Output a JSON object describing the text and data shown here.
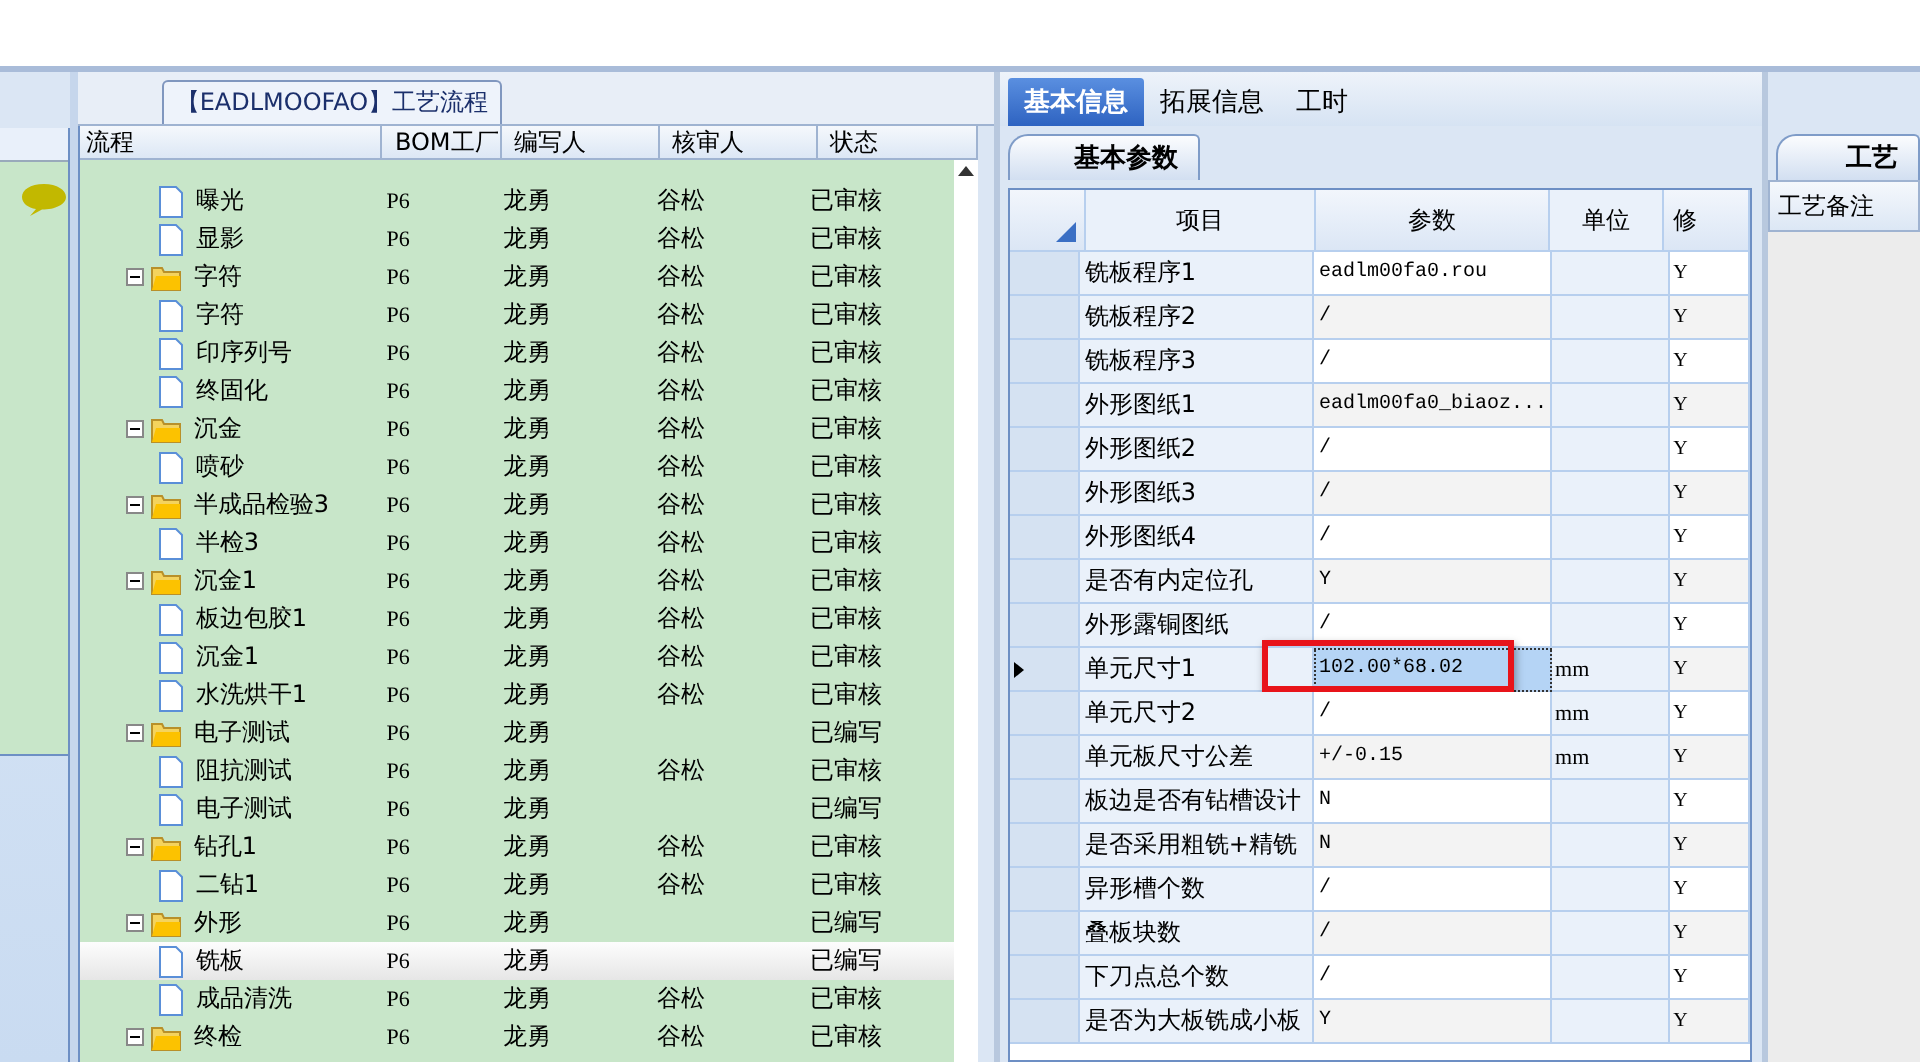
{
  "tree_panel": {
    "title": "【EADLMOOFAO】工艺流程",
    "columns": [
      "流程",
      "BOM工厂",
      "编写人",
      "核审人",
      "状态"
    ],
    "rows": [
      {
        "name": "曝光",
        "kind": "file",
        "bom": "P6",
        "writer": "龙勇",
        "reviewer": "谷松",
        "status": "已审核",
        "selected": false
      },
      {
        "name": "显影",
        "kind": "file",
        "bom": "P6",
        "writer": "龙勇",
        "reviewer": "谷松",
        "status": "已审核",
        "selected": false
      },
      {
        "name": "字符",
        "kind": "folder",
        "expanded": true,
        "bom": "P6",
        "writer": "龙勇",
        "reviewer": "谷松",
        "status": "已审核",
        "selected": false,
        "children": [
          {
            "name": "字符",
            "kind": "file",
            "bom": "P6",
            "writer": "龙勇",
            "reviewer": "谷松",
            "status": "已审核",
            "selected": false
          },
          {
            "name": "印序列号",
            "kind": "file",
            "bom": "P6",
            "writer": "龙勇",
            "reviewer": "谷松",
            "status": "已审核",
            "selected": false
          },
          {
            "name": "终固化",
            "kind": "file",
            "bom": "P6",
            "writer": "龙勇",
            "reviewer": "谷松",
            "status": "已审核",
            "selected": false
          }
        ]
      },
      {
        "name": "沉金",
        "kind": "folder",
        "expanded": true,
        "bom": "P6",
        "writer": "龙勇",
        "reviewer": "谷松",
        "status": "已审核",
        "selected": false,
        "children": [
          {
            "name": "喷砂",
            "kind": "file",
            "bom": "P6",
            "writer": "龙勇",
            "reviewer": "谷松",
            "status": "已审核",
            "selected": false
          }
        ]
      },
      {
        "name": "半成品检验3",
        "kind": "folder",
        "expanded": true,
        "bom": "P6",
        "writer": "龙勇",
        "reviewer": "谷松",
        "status": "已审核",
        "selected": false,
        "children": [
          {
            "name": "半检3",
            "kind": "file",
            "bom": "P6",
            "writer": "龙勇",
            "reviewer": "谷松",
            "status": "已审核",
            "selected": false
          }
        ]
      },
      {
        "name": "沉金1",
        "kind": "folder",
        "expanded": true,
        "bom": "P6",
        "writer": "龙勇",
        "reviewer": "谷松",
        "status": "已审核",
        "selected": false,
        "children": [
          {
            "name": "板边包胶1",
            "kind": "file",
            "bom": "P6",
            "writer": "龙勇",
            "reviewer": "谷松",
            "status": "已审核",
            "selected": false
          },
          {
            "name": "沉金1",
            "kind": "file",
            "bom": "P6",
            "writer": "龙勇",
            "reviewer": "谷松",
            "status": "已审核",
            "selected": false
          },
          {
            "name": "水洗烘干1",
            "kind": "file",
            "bom": "P6",
            "writer": "龙勇",
            "reviewer": "谷松",
            "status": "已审核",
            "selected": false
          }
        ]
      },
      {
        "name": "电子测试",
        "kind": "folder",
        "expanded": true,
        "bom": "P6",
        "writer": "龙勇",
        "status": "已编写",
        "selected": false,
        "children": [
          {
            "name": "阻抗测试",
            "kind": "file",
            "bom": "P6",
            "writer": "龙勇",
            "reviewer": "谷松",
            "status": "已审核",
            "selected": false
          },
          {
            "name": "电子测试",
            "kind": "file",
            "bom": "P6",
            "writer": "龙勇",
            "status": "已编写",
            "selected": false
          }
        ]
      },
      {
        "name": "钻孔1",
        "kind": "folder",
        "expanded": true,
        "bom": "P6",
        "writer": "龙勇",
        "reviewer": "谷松",
        "status": "已审核",
        "selected": false,
        "children": [
          {
            "name": "二钻1",
            "kind": "file",
            "bom": "P6",
            "writer": "龙勇",
            "reviewer": "谷松",
            "status": "已审核",
            "selected": false
          }
        ]
      },
      {
        "name": "外形",
        "kind": "folder",
        "expanded": true,
        "bom": "P6",
        "writer": "龙勇",
        "status": "已编写",
        "selected": false,
        "children": [
          {
            "name": "铣板",
            "kind": "file",
            "bom": "P6",
            "writer": "龙勇",
            "status": "已编写",
            "selected": true
          },
          {
            "name": "成品清洗",
            "kind": "file",
            "bom": "P6",
            "writer": "龙勇",
            "reviewer": "谷松",
            "status": "已审核",
            "selected": false
          }
        ]
      },
      {
        "name": "终检",
        "kind": "folder",
        "expanded": true,
        "bom": "P6",
        "writer": "龙勇",
        "reviewer": "谷松",
        "status": "已审核",
        "selected": false
      }
    ]
  },
  "info_panel": {
    "tabs": [
      {
        "label": "基本信息",
        "selected": true
      },
      {
        "label": "拓展信息",
        "selected": false
      },
      {
        "label": "工时",
        "selected": false
      }
    ],
    "subtab": "基本参数",
    "columns": [
      "项目",
      "参数",
      "单位",
      "修"
    ],
    "rows": [
      {
        "item": "铣板程序1",
        "value": "eadlm00fa0.rou",
        "modify": "Y",
        "selected": false
      },
      {
        "item": "铣板程序2",
        "value": "/",
        "modify": "Y",
        "selected": false
      },
      {
        "item": "铣板程序3",
        "value": "/",
        "modify": "Y",
        "selected": false
      },
      {
        "item": "外形图纸1",
        "value": "eadlm00fa0_biaoz...",
        "modify": "Y",
        "selected": false
      },
      {
        "item": "外形图纸2",
        "value": "/",
        "modify": "Y",
        "selected": false
      },
      {
        "item": "外形图纸3",
        "value": "/",
        "modify": "Y",
        "selected": false
      },
      {
        "item": "外形图纸4",
        "value": "/",
        "modify": "Y",
        "selected": false
      },
      {
        "item": "是否有内定位孔",
        "value": "Y",
        "modify": "Y",
        "selected": false
      },
      {
        "item": "外形露铜图纸",
        "value": "/",
        "modify": "Y",
        "selected": false
      },
      {
        "item": "单元尺寸1",
        "value": "102.00*68.02",
        "unit": "mm",
        "modify": "Y",
        "selected": true,
        "highlighted": true
      },
      {
        "item": "单元尺寸2",
        "value": "/",
        "unit": "mm",
        "modify": "Y",
        "selected": false
      },
      {
        "item": "单元板尺寸公差",
        "value": "+/-0.15",
        "unit": "mm",
        "modify": "Y",
        "selected": false
      },
      {
        "item": "板边是否有钻槽设计",
        "value": "N",
        "modify": "Y",
        "selected": false
      },
      {
        "item": "是否采用粗铣+精铣",
        "value": "N",
        "modify": "Y",
        "selected": false
      },
      {
        "item": "异形槽个数",
        "value": "/",
        "modify": "Y",
        "selected": false
      },
      {
        "item": "叠板块数",
        "value": "/",
        "modify": "Y",
        "selected": false
      },
      {
        "item": "下刀点总个数",
        "value": "/",
        "modify": "Y",
        "selected": false
      },
      {
        "item": "是否为大板铣成小板",
        "value": "Y",
        "modify": "Y",
        "selected": false
      }
    ]
  },
  "notes_panel": {
    "tab": "工艺",
    "header": "工艺备注"
  }
}
